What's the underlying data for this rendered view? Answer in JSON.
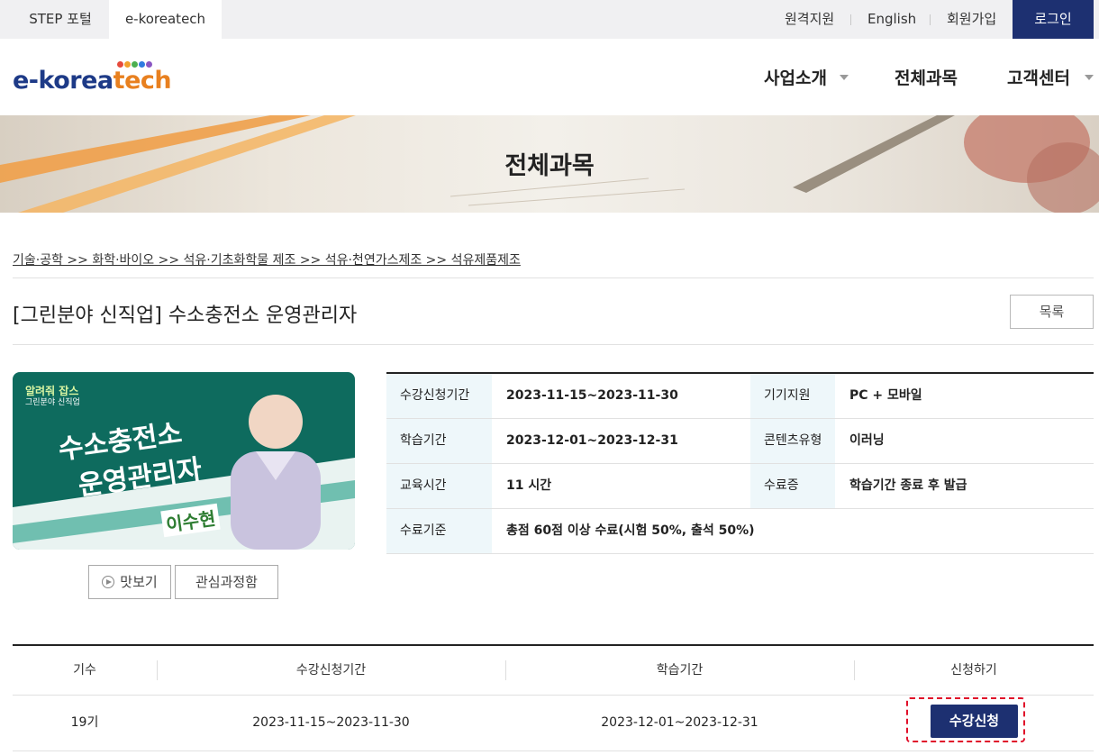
{
  "topbar": {
    "tabs": [
      "STEP 포털",
      "e-koreatech"
    ],
    "links": [
      "원격지원",
      "English",
      "회원가입"
    ],
    "login": "로그인"
  },
  "header": {
    "logo_main": "e-korea",
    "logo_accent": "tech",
    "logo_dot_colors": [
      "#e64b3c",
      "#f2a12b",
      "#4caf50",
      "#2f7be0",
      "#8a56c2"
    ],
    "nav": [
      "사업소개",
      "전체과목",
      "고객센터"
    ]
  },
  "banner": {
    "title": "전체과목"
  },
  "breadcrumb": "기술·공학 >> 화학·바이오 >> 석유·기초화학물 제조 >> 석유·천연가스제조 >> 석유제품제조",
  "course": {
    "title": "[그린분야 신직업] 수소충전소 운영관리자",
    "list_button": "목록",
    "thumbnail": {
      "tag": "알려줘 잡스",
      "subtitle": "그린분야 신직업",
      "headline_1": "수소충전소",
      "headline_2": "운영관리자",
      "instructor": "이수현"
    },
    "preview_button": "맛보기",
    "favorite_button": "관심과정함",
    "info": [
      {
        "label": "수강신청기간",
        "value": "2023-11-15~2023-11-30",
        "label2": "기기지원",
        "value2": "PC + 모바일"
      },
      {
        "label": "학습기간",
        "value": "2023-12-01~2023-12-31",
        "label2": "콘텐츠유형",
        "value2": "이러닝"
      },
      {
        "label": "교육시간",
        "value": "11 시간",
        "label2": "수료증",
        "value2": "학습기간 종료 후 발급"
      },
      {
        "label": "수료기준",
        "value": "총점 60점 이상 수료(시험 50%, 출석 50%)"
      }
    ]
  },
  "sessions": {
    "headers": [
      "기수",
      "수강신청기간",
      "학습기간",
      "신청하기"
    ],
    "rows": [
      {
        "term": "19기",
        "enroll_period": "2023-11-15~2023-11-30",
        "study_period": "2023-12-01~2023-12-31",
        "action": "수강신청"
      }
    ]
  },
  "colors": {
    "navy": "#1d3071",
    "highlight": "#e0102a",
    "label_bg": "#eef7fa"
  }
}
